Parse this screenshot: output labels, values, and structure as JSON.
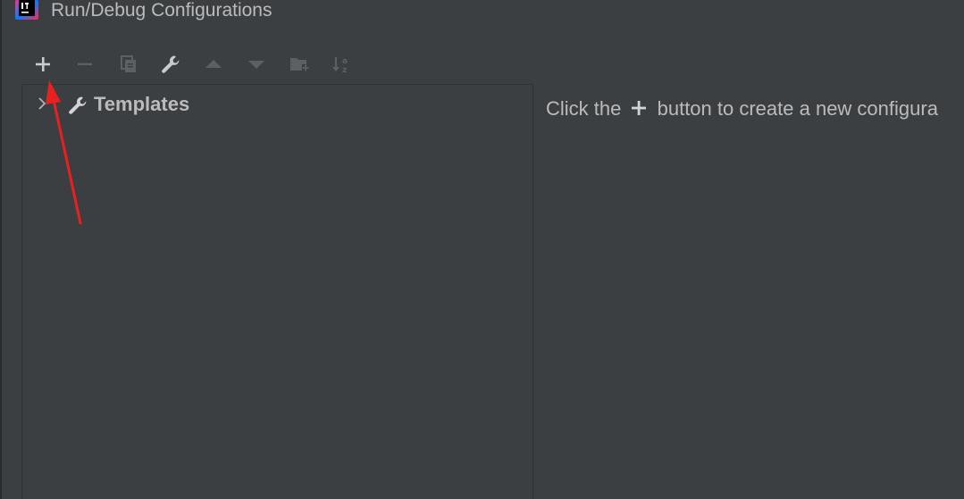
{
  "window": {
    "title": "Run/Debug Configurations",
    "app_icon": "intellij-idea-icon"
  },
  "toolbar": {
    "buttons": [
      {
        "name": "add-button",
        "icon": "plus-icon",
        "enabled": true
      },
      {
        "name": "remove-button",
        "icon": "minus-icon",
        "enabled": false
      },
      {
        "name": "copy-button",
        "icon": "copy-icon",
        "enabled": false
      },
      {
        "name": "edit-templates-button",
        "icon": "wrench-icon",
        "enabled": true
      },
      {
        "name": "move-up-button",
        "icon": "triangle-up-icon",
        "enabled": false
      },
      {
        "name": "move-down-button",
        "icon": "triangle-down-icon",
        "enabled": false
      },
      {
        "name": "new-folder-button",
        "icon": "folder-plus-icon",
        "enabled": false
      },
      {
        "name": "sort-button",
        "icon": "sort-az-icon",
        "enabled": false
      }
    ]
  },
  "tree": {
    "items": [
      {
        "label": "Templates",
        "icon": "wrench-icon",
        "expanded": false
      }
    ]
  },
  "main": {
    "hint_prefix": "Click the",
    "hint_icon": "plus-icon",
    "hint_suffix": "button to create a new configura"
  },
  "annotation": {
    "type": "red-arrow",
    "points_to": "add-button",
    "color": "#e8201f"
  },
  "colors": {
    "background": "#3c3f41",
    "text": "#bbbbbb",
    "icon_enabled": "#afb1b3",
    "icon_disabled": "#5d6063",
    "arrow": "#e8201f"
  }
}
